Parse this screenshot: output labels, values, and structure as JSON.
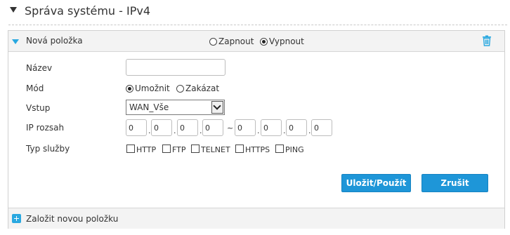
{
  "section": {
    "title": "Správa systému - IPv4"
  },
  "entry": {
    "title": "Nová položka",
    "state_options": {
      "on": "Zapnout",
      "off": "Vypnout"
    },
    "state_selected": "off"
  },
  "form": {
    "name_label": "Název",
    "name_value": "",
    "mode_label": "Mód",
    "mode_options": {
      "allow": "Umožnit",
      "deny": "Zakázat"
    },
    "mode_selected": "allow",
    "input_label": "Vstup",
    "input_value": "WAN_Vše",
    "ip_range_label": "IP rozsah",
    "ip_start": [
      "0",
      "0",
      "0",
      "0"
    ],
    "ip_end": [
      "0",
      "0",
      "0",
      "0"
    ],
    "ip_separator": "~",
    "service_label": "Typ služby",
    "services": [
      "HTTP",
      "FTP",
      "TELNET",
      "HTTPS",
      "PING"
    ]
  },
  "buttons": {
    "save": "Uložit/Použít",
    "cancel": "Zrušit"
  },
  "footer": {
    "add_label": "Založit novou položku"
  },
  "colors": {
    "accent": "#1e96d8",
    "icon_blue": "#29a8e0"
  },
  "icons": {
    "collapse": "triangle-down-icon",
    "delete": "trash-icon",
    "add": "plus-icon"
  }
}
